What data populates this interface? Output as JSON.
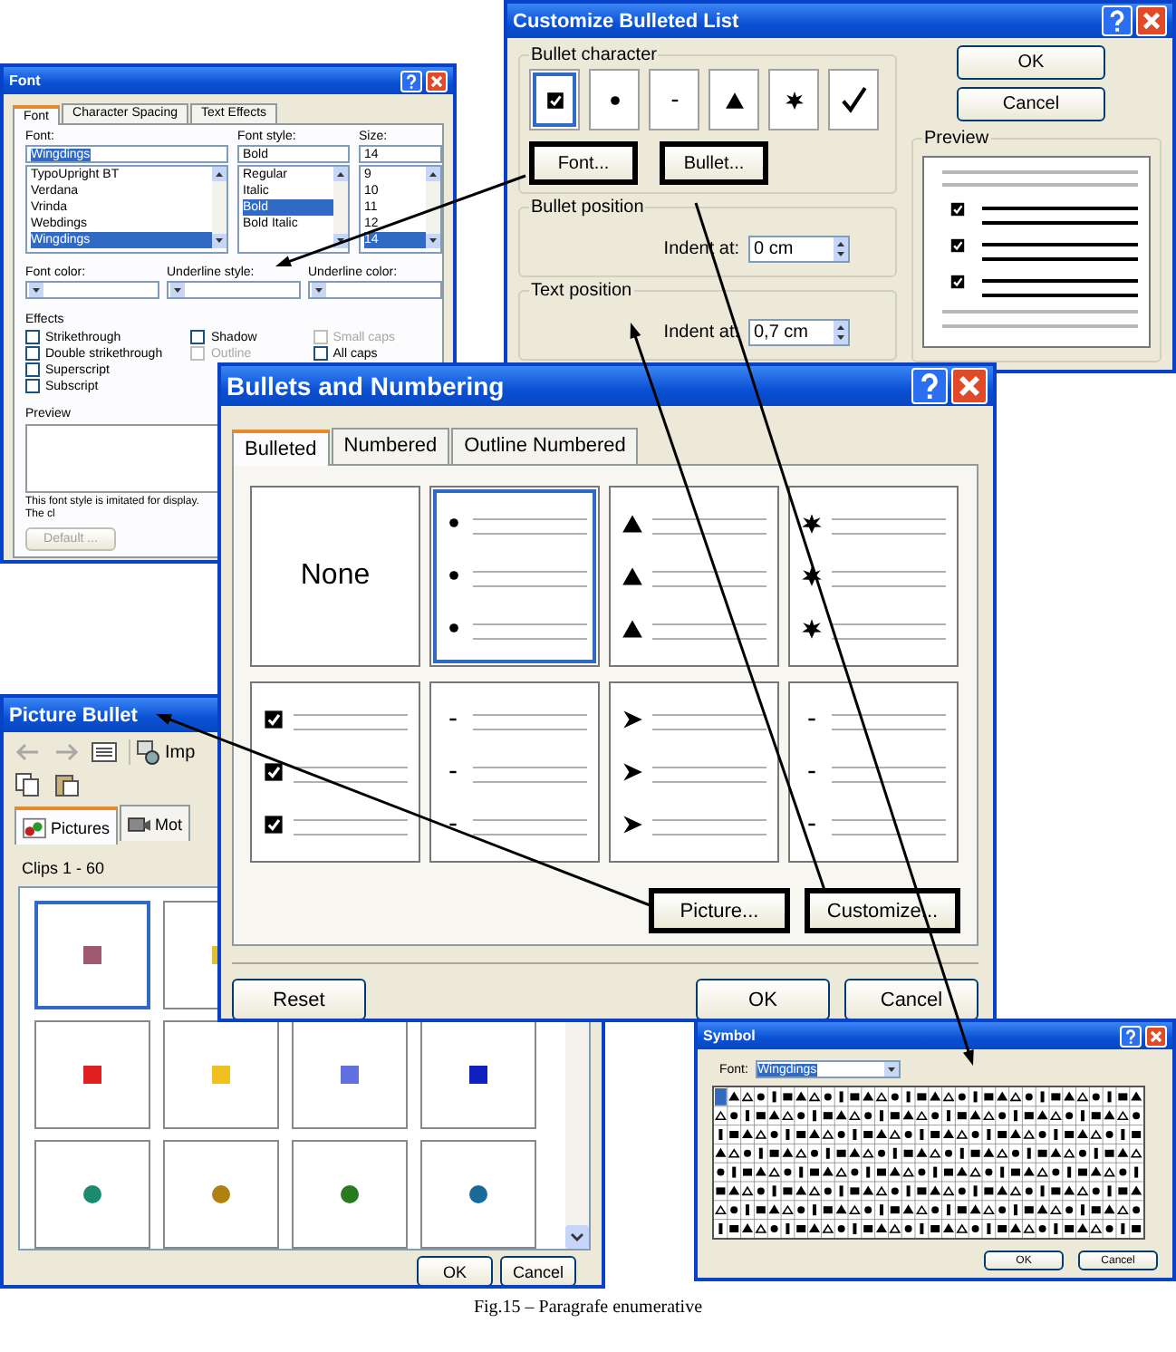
{
  "font_dialog": {
    "title": "Font",
    "tabs": [
      {
        "label": "Font",
        "selected": true
      },
      {
        "label": "Character Spacing",
        "selected": false
      },
      {
        "label": "Text Effects",
        "selected": false
      }
    ],
    "font": {
      "label": "Font:",
      "value": "Wingdings",
      "options": [
        {
          "label": "TypoUpright BT",
          "selected": false
        },
        {
          "label": "Verdana",
          "selected": false
        },
        {
          "label": "Vrinda",
          "selected": false
        },
        {
          "label": "Webdings",
          "selected": false
        },
        {
          "label": "Wingdings",
          "selected": true
        }
      ]
    },
    "font_style": {
      "label": "Font style:",
      "value": "Bold",
      "options": [
        {
          "label": "Regular",
          "selected": false
        },
        {
          "label": "Italic",
          "selected": false
        },
        {
          "label": "Bold",
          "selected": true
        },
        {
          "label": "Bold Italic",
          "selected": false
        }
      ]
    },
    "size": {
      "label": "Size:",
      "value": "14",
      "options": [
        {
          "label": "9",
          "selected": false
        },
        {
          "label": "10",
          "selected": false
        },
        {
          "label": "11",
          "selected": false
        },
        {
          "label": "12",
          "selected": false
        },
        {
          "label": "14",
          "selected": true
        }
      ]
    },
    "dropdowns": [
      {
        "label": "Font color:"
      },
      {
        "label": "Underline style:"
      },
      {
        "label": "Underline color:"
      }
    ],
    "effects": {
      "label": "Effects",
      "columns": [
        {
          "items": [
            {
              "label": "Strikethrough",
              "checked": false,
              "disabled": false
            },
            {
              "label": "Double strikethrough",
              "checked": false,
              "disabled": false
            },
            {
              "label": "Superscript",
              "checked": false,
              "disabled": false
            },
            {
              "label": "Subscript",
              "checked": false,
              "disabled": false
            }
          ]
        },
        {
          "items": [
            {
              "label": "Shadow",
              "checked": false,
              "disabled": false
            },
            {
              "label": "Outline",
              "checked": false,
              "disabled": true
            }
          ]
        },
        {
          "items": [
            {
              "label": "Small caps",
              "checked": false,
              "disabled": true
            },
            {
              "label": "All caps",
              "checked": false,
              "disabled": false
            }
          ]
        }
      ]
    },
    "preview": {
      "label": "Preview"
    },
    "note": "This font style is imitated for display. The cl",
    "default_button": {
      "label": "Default ...",
      "disabled": true
    }
  },
  "customize_dialog": {
    "title": "Customize Bulleted List",
    "bullet_character": {
      "label": "Bullet character",
      "options": [
        {
          "kind": "checkbox",
          "selected": true
        },
        {
          "kind": "dot",
          "selected": false
        },
        {
          "kind": "dash",
          "selected": false
        },
        {
          "kind": "triangle",
          "selected": false
        },
        {
          "kind": "star",
          "selected": false
        },
        {
          "kind": "check",
          "selected": false
        }
      ],
      "buttons": [
        {
          "label": "Font...",
          "highlighted": true
        },
        {
          "label": "Bullet...",
          "highlighted": true
        }
      ]
    },
    "bullet_position": {
      "label": "Bullet position",
      "indent_label": "Indent at:",
      "indent_value": "0 cm"
    },
    "text_position": {
      "label": "Text position",
      "indent_label": "Indent at:",
      "indent_value": "0,7 cm"
    },
    "buttons": [
      {
        "label": "OK",
        "highlighted": false
      },
      {
        "label": "Cancel",
        "highlighted": false
      }
    ],
    "preview": {
      "label": "Preview"
    }
  },
  "picture_dialog": {
    "title": "Picture Bullet",
    "toolbar": {
      "import_label": "Imp"
    },
    "tabs": [
      {
        "label": "Pictures",
        "selected": true
      },
      {
        "label": "Mot",
        "selected": false
      }
    ],
    "clips_label": "Clips 1 - 60",
    "rows": [
      {
        "clips": [
          {
            "kind": "square",
            "color": "#a05a70",
            "selected": true
          },
          {
            "kind": "square",
            "color": "#e0c030",
            "selected": false
          }
        ]
      },
      {
        "clips": [
          {
            "kind": "square",
            "color": "#e02020",
            "selected": false
          },
          {
            "kind": "square",
            "color": "#f0c020",
            "selected": false
          },
          {
            "kind": "square",
            "color": "#6070e0",
            "selected": false
          },
          {
            "kind": "square",
            "color": "#1020c0",
            "selected": false
          }
        ]
      },
      {
        "clips": [
          {
            "kind": "sphere",
            "color": "#1a8a70",
            "selected": false
          },
          {
            "kind": "sphere",
            "color": "#b08010",
            "selected": false
          },
          {
            "kind": "sphere",
            "color": "#2a7a20",
            "selected": false
          },
          {
            "kind": "sphere",
            "color": "#1a6a9a",
            "selected": false
          }
        ]
      }
    ],
    "buttons": [
      {
        "label": "OK"
      },
      {
        "label": "Cancel"
      }
    ]
  },
  "bullets_dialog": {
    "title": "Bullets and Numbering",
    "tabs": [
      {
        "label": "Bulleted",
        "selected": true
      },
      {
        "label": "Numbered",
        "selected": false
      },
      {
        "label": "Outline Numbered",
        "selected": false
      }
    ],
    "styles": [
      {
        "kind": "none",
        "label": "None",
        "selected": false
      },
      {
        "kind": "dot",
        "selected": true
      },
      {
        "kind": "triangle",
        "selected": false
      },
      {
        "kind": "star",
        "selected": false
      },
      {
        "kind": "checkbox",
        "selected": false
      },
      {
        "kind": "dash",
        "selected": false
      },
      {
        "kind": "arrowhead",
        "selected": false
      },
      {
        "kind": "dash",
        "selected": false
      }
    ],
    "buttons": [
      {
        "label": "Picture...",
        "highlighted": true
      },
      {
        "label": "Customize...",
        "highlighted": true
      }
    ],
    "footer_buttons": [
      {
        "label": "Reset"
      },
      {
        "label": "OK"
      },
      {
        "label": "Cancel"
      }
    ]
  },
  "symbol_dialog": {
    "title": "Symbol",
    "font_label": "Font:",
    "font_value": "Wingdings",
    "buttons": [
      {
        "label": "OK"
      },
      {
        "label": "Cancel"
      }
    ]
  },
  "caption": "Fig.15 – Paragrafe enumerative"
}
